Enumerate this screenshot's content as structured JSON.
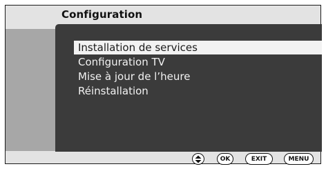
{
  "screen": {
    "title": "Configuration"
  },
  "menu": {
    "items": [
      {
        "label": "Installation de services",
        "selected": true
      },
      {
        "label": "Configuration TV",
        "selected": false
      },
      {
        "label": "Mise à jour de l’heure",
        "selected": false
      },
      {
        "label": "Réinstallation",
        "selected": false
      }
    ]
  },
  "controls": {
    "nav_icon": "up-down-arrows-icon",
    "ok_label": "OK",
    "exit_label": "EXIT",
    "menu_label": "MENU"
  },
  "colors": {
    "panel": "#3b3b3b",
    "selection": "#f2f2f2",
    "band": "#a7a7a7",
    "frame_bg": "#e3e3e3"
  }
}
